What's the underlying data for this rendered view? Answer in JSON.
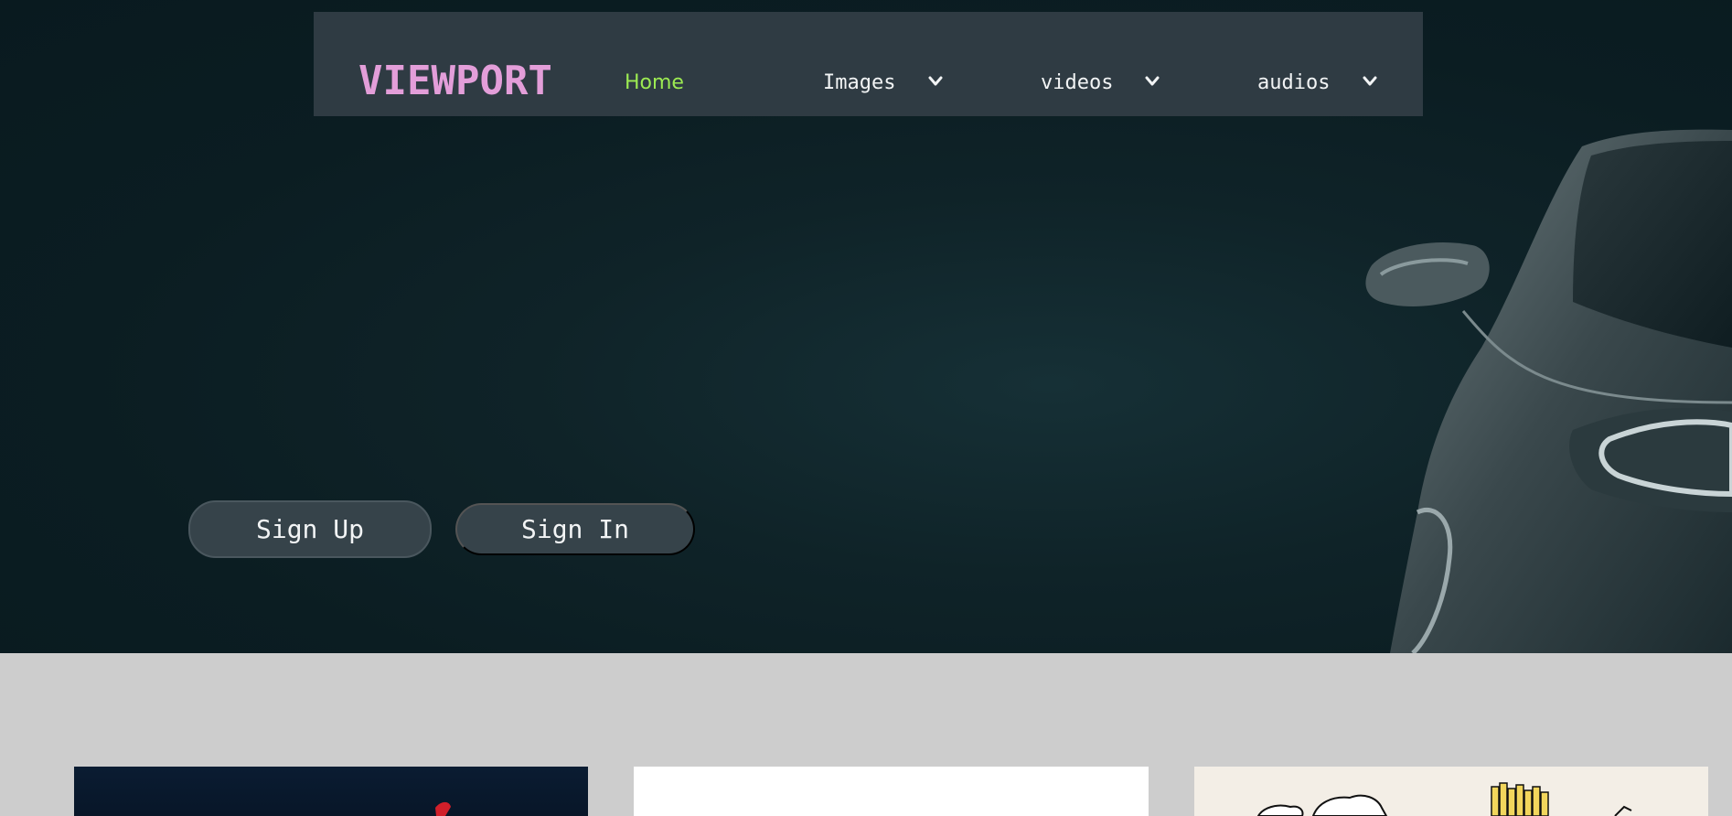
{
  "navbar": {
    "logo": "VIEWPORT",
    "links": [
      {
        "label": "Home",
        "active": true
      },
      {
        "label": "Images",
        "has_dropdown": true,
        "icon": "chevron-down-icon"
      },
      {
        "label": "videos",
        "has_dropdown": true,
        "icon": "chevron-down-icon"
      },
      {
        "label": "audios",
        "has_dropdown": true,
        "icon": "chevron-down-icon"
      }
    ]
  },
  "hero": {
    "signup_label": "Sign Up",
    "signin_label": "Sign In",
    "image": "sports-car-silhouette"
  },
  "gallery": {
    "cards": [
      {
        "image": "dark-blue-photo"
      },
      {
        "image": "white-card"
      },
      {
        "image": "fries-illustration"
      }
    ]
  },
  "colors": {
    "hero_bg": "#0b1d22",
    "navbar_bg": "#2f3b43",
    "logo": "#e39ed9",
    "active_link": "#9cea52",
    "button_bg": "#36434a",
    "page_bg": "#cdcdcd"
  }
}
